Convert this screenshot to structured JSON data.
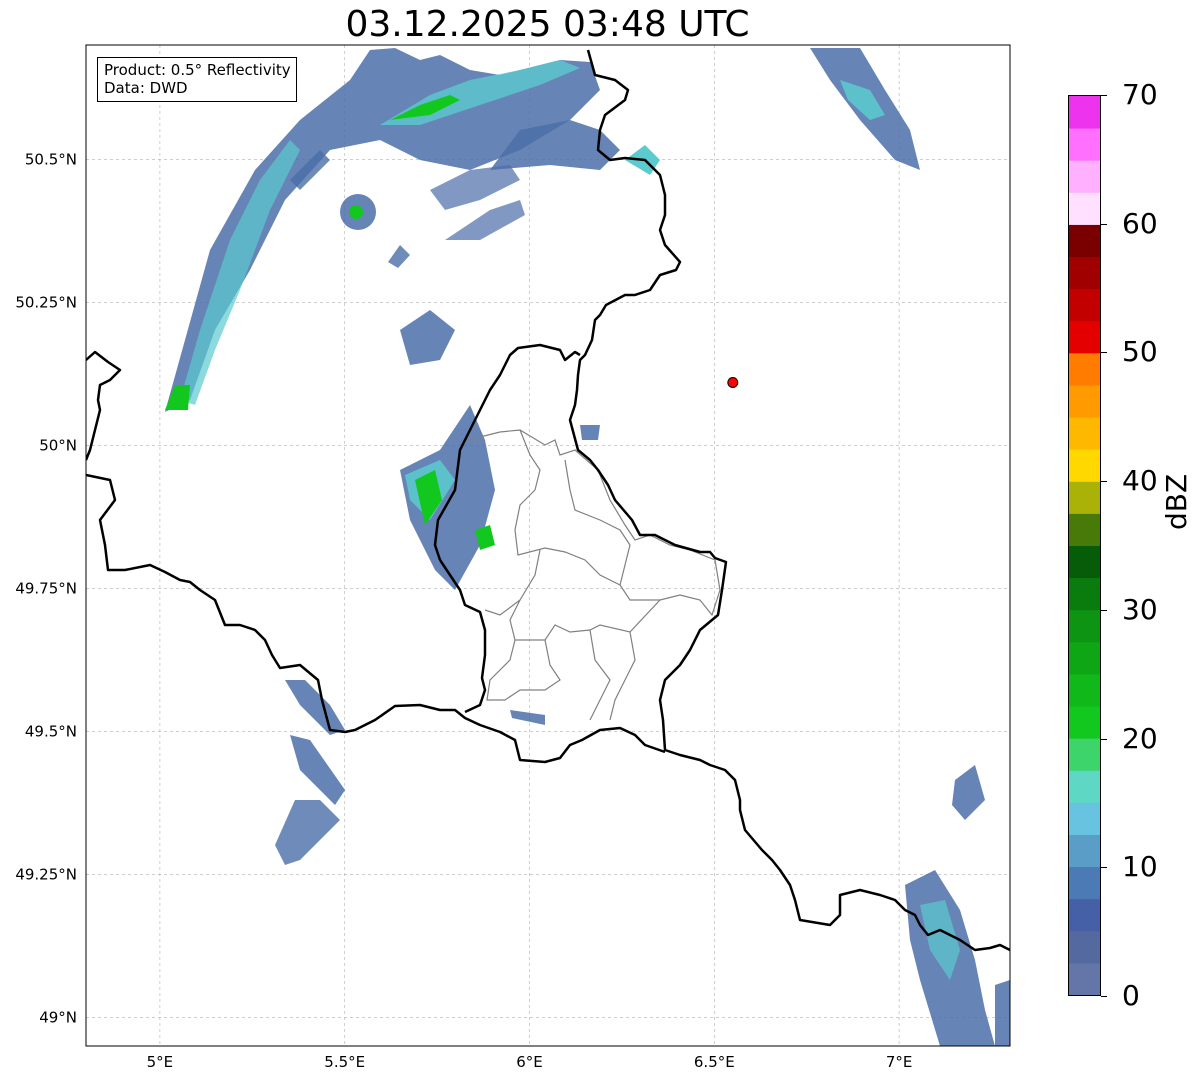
{
  "title": "03.12.2025 03:48 UTC",
  "info": {
    "product": "Product: 0.5° Reflectivity",
    "source": "Data: DWD"
  },
  "axes": {
    "lon_ticks": [
      {
        "value": 5.0,
        "label": "5°E"
      },
      {
        "value": 5.5,
        "label": "5.5°E"
      },
      {
        "value": 6.0,
        "label": "6°E"
      },
      {
        "value": 6.5,
        "label": "6.5°E"
      },
      {
        "value": 7.0,
        "label": "7°E"
      }
    ],
    "lat_ticks": [
      {
        "value": 50.5,
        "label": "50.5°N"
      },
      {
        "value": 50.25,
        "label": "50.25°N"
      },
      {
        "value": 50.0,
        "label": "50°N"
      },
      {
        "value": 49.75,
        "label": "49.75°N"
      },
      {
        "value": 49.5,
        "label": "49.5°N"
      },
      {
        "value": 49.25,
        "label": "49.25°N"
      },
      {
        "value": 49.0,
        "label": "49°N"
      }
    ],
    "lon_range": [
      4.8,
      7.3
    ],
    "lat_range": [
      48.95,
      50.7
    ],
    "grid": true
  },
  "marker": {
    "lon": 6.55,
    "lat": 50.11,
    "color": "#ff0000"
  },
  "colorbar": {
    "unit": "dBZ",
    "range": [
      0,
      70
    ],
    "labels": [
      "0",
      "10",
      "20",
      "30",
      "40",
      "50",
      "60",
      "70"
    ],
    "colors": [
      "#6475a8",
      "#5369a0",
      "#4560a6",
      "#4b7ab4",
      "#5a9ec8",
      "#67c3df",
      "#5ed8c4",
      "#3dd46b",
      "#12c81e",
      "#10b81a",
      "#0fa616",
      "#0c9412",
      "#0a7c0e",
      "#065c08",
      "#477a08",
      "#aab208",
      "#ffd800",
      "#ffb800",
      "#ff9a00",
      "#ff7c00",
      "#e50000",
      "#c20000",
      "#a00000",
      "#7a0000",
      "#ffe0ff",
      "#ffb0ff",
      "#ff70ff",
      "#ee33ee"
    ]
  },
  "colors": {
    "national_border": "#000000",
    "district_border": "#808080",
    "grid": "#b0b0b0",
    "echo_low": "#4b6ea8",
    "echo_mid": "#5ccbd0",
    "echo_high": "#12c81e"
  }
}
